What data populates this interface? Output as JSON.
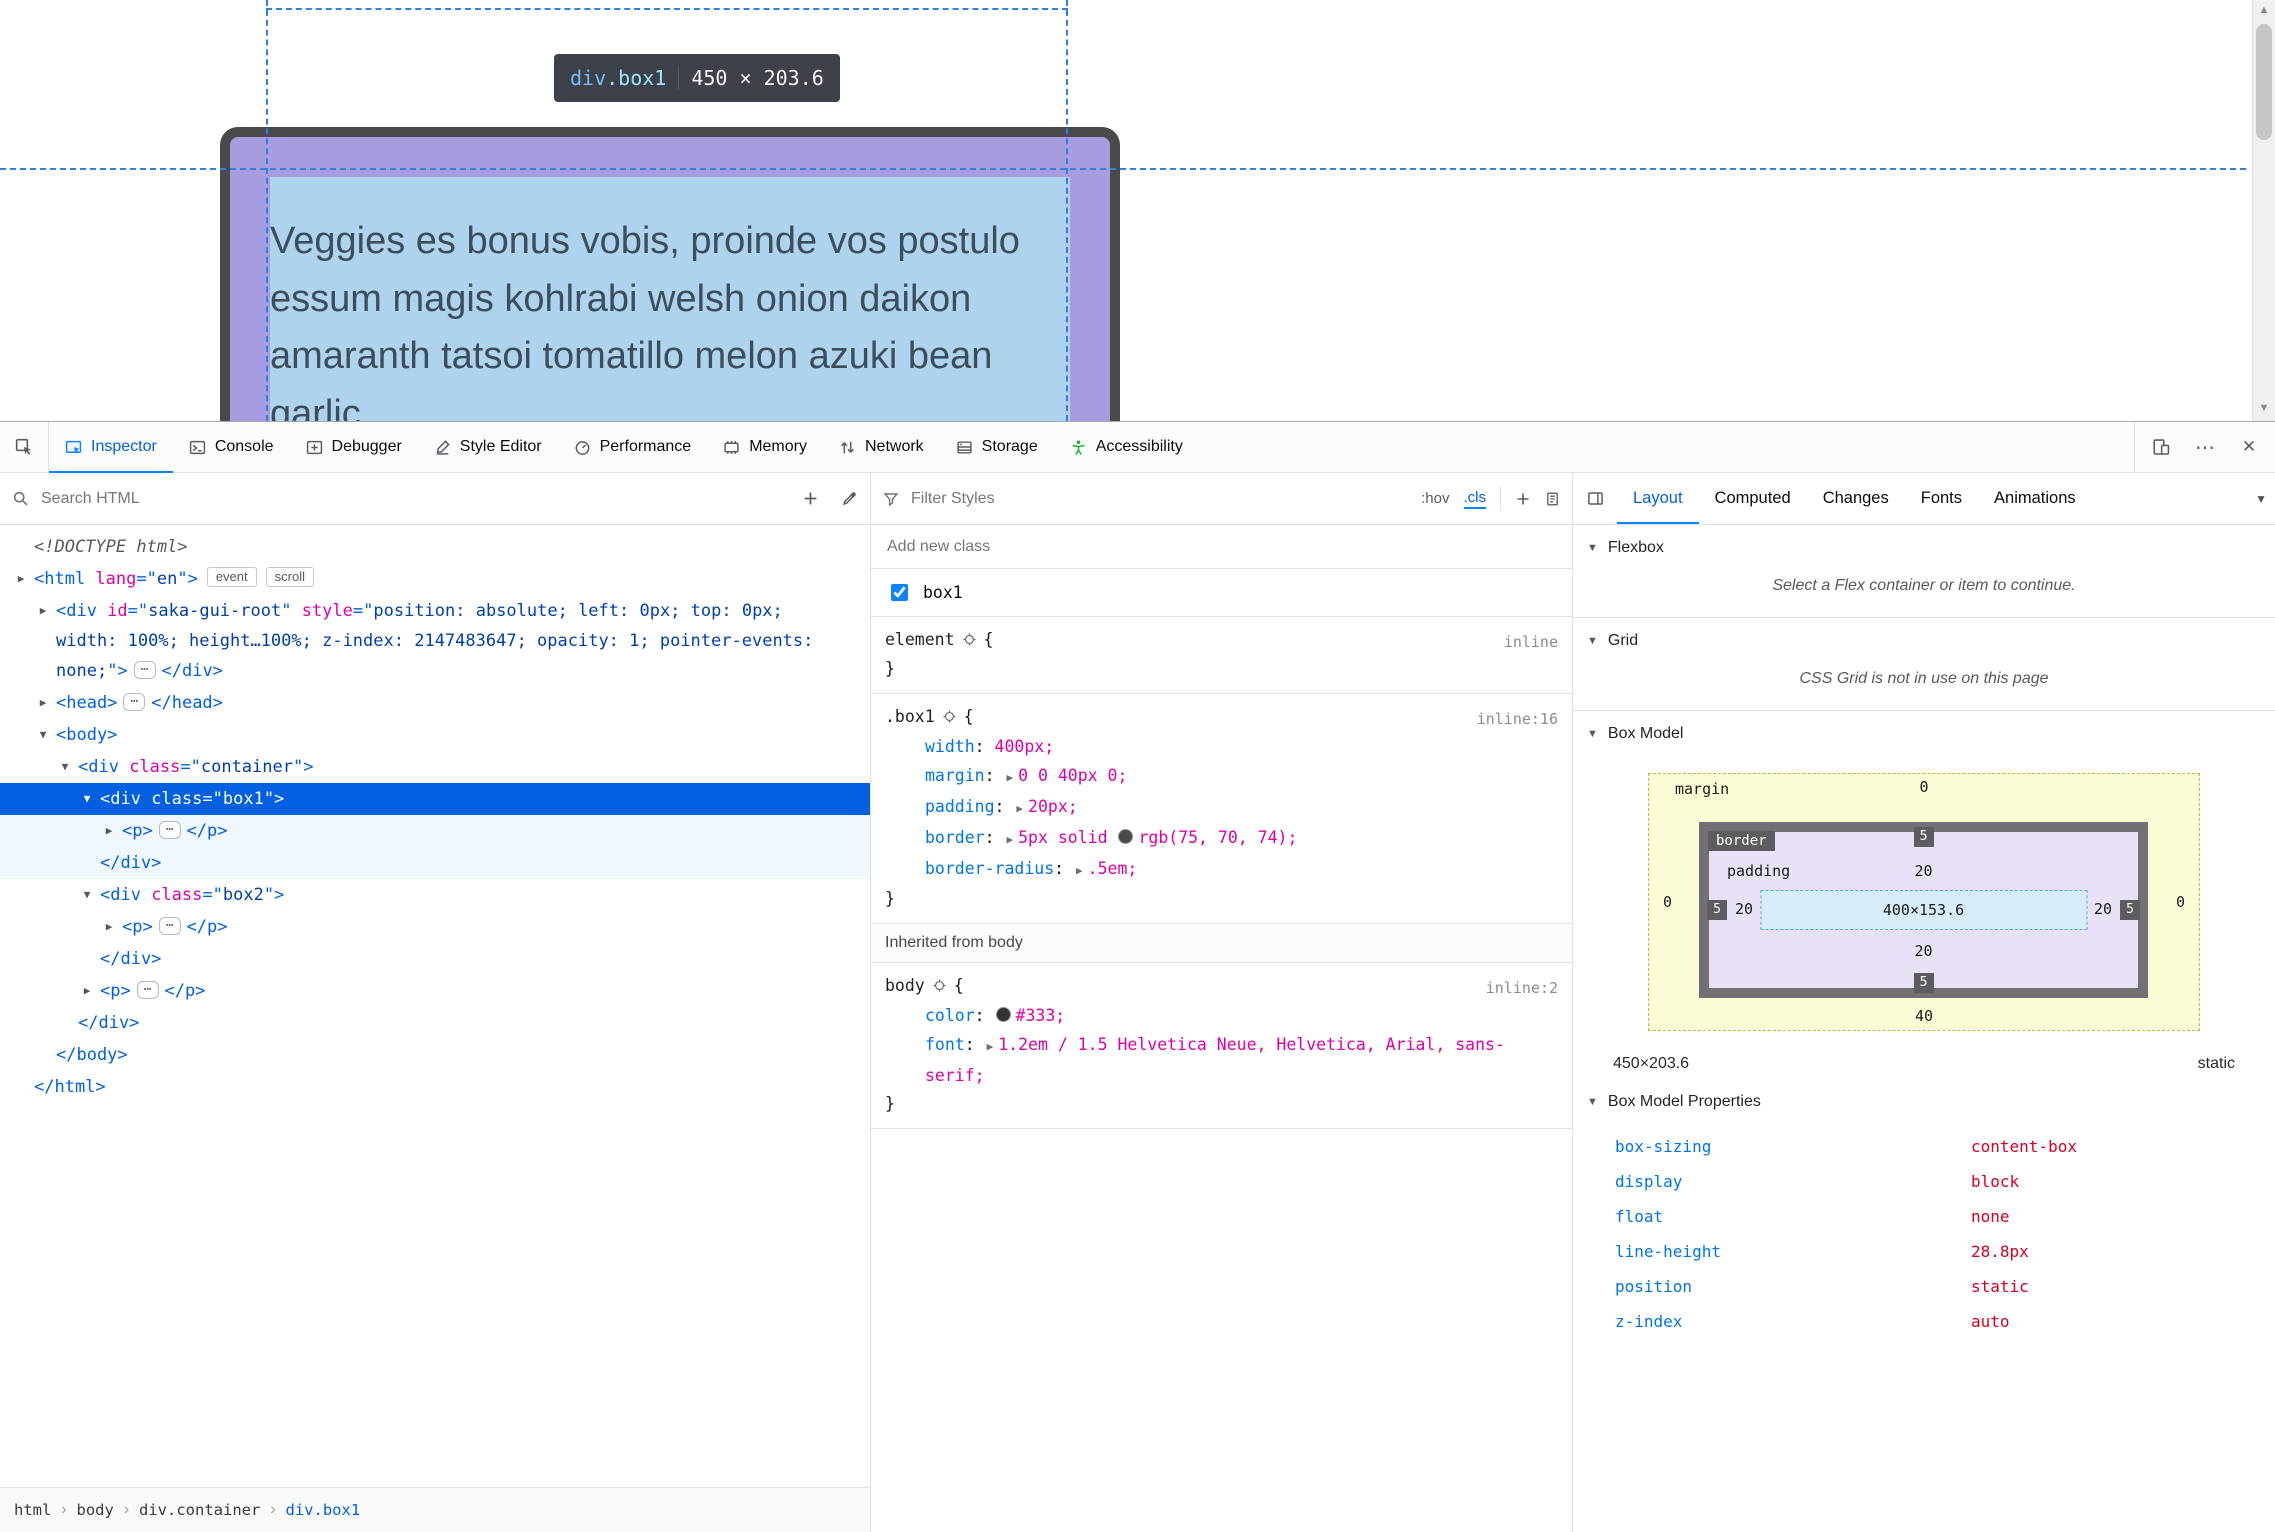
{
  "colors": {
    "accent": "#0060df",
    "selection_bg": "#0060df",
    "tag": "#0060df",
    "attr_name": "#dd00a9",
    "attr_value": "#003eaa",
    "property_name": "#0074e8",
    "property_value": "#dd00a9",
    "box_border_swatch": "#4b4a4a",
    "body_color_swatch": "#333333",
    "accessibility_icon": "#2bb236"
  },
  "page_view": {
    "tooltip": {
      "tag": "div",
      "cls": ".box1",
      "dims": "450 × 203.6"
    },
    "box_lines": [
      "Veggies es bonus vobis, proinde vos postulo",
      "essum magis kohlrabi welsh onion daikon",
      "amaranth tatsoi tomatillo melon azuki bean",
      "garlic"
    ]
  },
  "toolbar": {
    "tabs": [
      {
        "id": "inspector",
        "label": "Inspector",
        "icon": "inspector-icon",
        "active": true
      },
      {
        "id": "console",
        "label": "Console",
        "icon": "console-icon"
      },
      {
        "id": "debugger",
        "label": "Debugger",
        "icon": "debugger-icon"
      },
      {
        "id": "style-editor",
        "label": "Style Editor",
        "icon": "style-editor-icon"
      },
      {
        "id": "performance",
        "label": "Performance",
        "icon": "performance-icon"
      },
      {
        "id": "memory",
        "label": "Memory",
        "icon": "memory-icon"
      },
      {
        "id": "network",
        "label": "Network",
        "icon": "network-icon"
      },
      {
        "id": "storage",
        "label": "Storage",
        "icon": "storage-icon"
      },
      {
        "id": "accessibility",
        "label": "Accessibility",
        "icon": "accessibility-icon",
        "icon_color": "#2bb236"
      }
    ]
  },
  "markup": {
    "search_placeholder": "Search HTML",
    "rows": [
      {
        "name": "node-doctype",
        "indent": 0,
        "arrow": null,
        "parts": [
          {
            "c": "doc",
            "s": "<!DOCTYPE html>"
          }
        ]
      },
      {
        "name": "node-html",
        "indent": 0,
        "arrow": "c",
        "parts": [
          {
            "c": "tag",
            "s": "<html "
          },
          {
            "c": "an",
            "s": "lang"
          },
          {
            "c": "tag",
            "s": "=\""
          },
          {
            "c": "av",
            "s": "en"
          },
          {
            "c": "tag",
            "s": "\">"
          }
        ],
        "badges": [
          "event",
          "scroll"
        ]
      },
      {
        "name": "node-saka-gui-root",
        "indent": 1,
        "arrow": "c",
        "parts": [
          {
            "c": "tag",
            "s": "<div "
          },
          {
            "c": "an",
            "s": "id"
          },
          {
            "c": "tag",
            "s": "=\""
          },
          {
            "c": "av",
            "s": "saka-gui-root"
          },
          {
            "c": "tag",
            "s": "\" "
          },
          {
            "c": "an",
            "s": "style"
          },
          {
            "c": "tag",
            "s": "=\""
          },
          {
            "c": "av",
            "s": "position: absolute; left: 0px; top: 0px; width: 100%; height…100%; z-index: 2147483647; opacity: 1; pointer-events: none;"
          },
          {
            "c": "tag",
            "s": "\">"
          },
          {
            "c": "pill",
            "s": "⋯"
          },
          {
            "c": "tag",
            "s": "</div>"
          }
        ]
      },
      {
        "name": "node-head",
        "indent": 1,
        "arrow": "c",
        "parts": [
          {
            "c": "tag",
            "s": "<head>"
          },
          {
            "c": "pill",
            "s": "⋯"
          },
          {
            "c": "tag",
            "s": "</head>"
          }
        ]
      },
      {
        "name": "node-body",
        "indent": 1,
        "arrow": "o",
        "parts": [
          {
            "c": "tag",
            "s": "<body>"
          }
        ]
      },
      {
        "name": "node-div-container",
        "indent": 2,
        "arrow": "o",
        "parts": [
          {
            "c": "tag",
            "s": "<div "
          },
          {
            "c": "an",
            "s": "class"
          },
          {
            "c": "tag",
            "s": "=\""
          },
          {
            "c": "av",
            "s": "container"
          },
          {
            "c": "tag",
            "s": "\">"
          }
        ]
      },
      {
        "name": "node-div-box1",
        "indent": 3,
        "arrow": "o",
        "state": "selected",
        "parts": [
          {
            "c": "tag",
            "s": "<div "
          },
          {
            "c": "an",
            "s": "class"
          },
          {
            "c": "tag",
            "s": "=\""
          },
          {
            "c": "av",
            "s": "box1"
          },
          {
            "c": "tag",
            "s": "\">"
          }
        ]
      },
      {
        "name": "node-box1-p",
        "indent": 4,
        "arrow": "c",
        "state": "tint",
        "parts": [
          {
            "c": "tag",
            "s": "<p>"
          },
          {
            "c": "pill",
            "s": "⋯"
          },
          {
            "c": "tag",
            "s": "</p>"
          }
        ]
      },
      {
        "name": "node-box1-close",
        "indent": 3,
        "arrow": null,
        "state": "tint",
        "parts": [
          {
            "c": "tag",
            "s": "</div>"
          }
        ]
      },
      {
        "name": "node-div-box2",
        "indent": 3,
        "arrow": "o",
        "parts": [
          {
            "c": "tag",
            "s": "<div "
          },
          {
            "c": "an",
            "s": "class"
          },
          {
            "c": "tag",
            "s": "=\""
          },
          {
            "c": "av",
            "s": "box2"
          },
          {
            "c": "tag",
            "s": "\">"
          }
        ]
      },
      {
        "name": "node-box2-p",
        "indent": 4,
        "arrow": "c",
        "parts": [
          {
            "c": "tag",
            "s": "<p>"
          },
          {
            "c": "pill",
            "s": "⋯"
          },
          {
            "c": "tag",
            "s": "</p>"
          }
        ]
      },
      {
        "name": "node-box2-close",
        "indent": 3,
        "arrow": null,
        "parts": [
          {
            "c": "tag",
            "s": "</div>"
          }
        ]
      },
      {
        "name": "node-container-p",
        "indent": 3,
        "arrow": "c",
        "parts": [
          {
            "c": "tag",
            "s": "<p>"
          },
          {
            "c": "pill",
            "s": "⋯"
          },
          {
            "c": "tag",
            "s": "</p>"
          }
        ]
      },
      {
        "name": "node-container-close",
        "indent": 2,
        "arrow": null,
        "parts": [
          {
            "c": "tag",
            "s": "</div>"
          }
        ]
      },
      {
        "name": "node-body-close",
        "indent": 1,
        "arrow": null,
        "parts": [
          {
            "c": "tag",
            "s": "</body>"
          }
        ]
      },
      {
        "name": "node-html-close",
        "indent": 0,
        "arrow": null,
        "parts": [
          {
            "c": "tag",
            "s": "</html>"
          }
        ]
      }
    ],
    "breadcrumbs": [
      "html",
      "body",
      "div.container",
      "div.box1"
    ]
  },
  "rules": {
    "filter_placeholder": "Filter Styles",
    "pseudo_label": ":hov",
    "class_label": ".cls",
    "add_class_placeholder": "Add new class",
    "class_toggle": {
      "name": "box1",
      "checked": true
    },
    "sections": [
      {
        "type": "rule",
        "selector": "element",
        "link": "inline",
        "declarations": []
      },
      {
        "type": "rule",
        "selector": ".box1",
        "link": "inline:16",
        "declarations": [
          {
            "name": "width",
            "parts": [
              {
                "t": "t",
                "s": "400px"
              }
            ]
          },
          {
            "name": "margin",
            "expand": true,
            "parts": [
              {
                "t": "t",
                "s": "0 0 40px 0"
              }
            ]
          },
          {
            "name": "padding",
            "expand": true,
            "parts": [
              {
                "t": "t",
                "s": "20px"
              }
            ]
          },
          {
            "name": "border",
            "expand": true,
            "parts": [
              {
                "t": "t",
                "s": "5px solid "
              },
              {
                "t": "sw",
                "s": "#4b4a4a"
              },
              {
                "t": "t",
                "s": "rgb(75, 70, 74)"
              }
            ]
          },
          {
            "name": "border-radius",
            "expand": true,
            "parts": [
              {
                "t": "t",
                "s": ".5em"
              }
            ]
          }
        ]
      },
      {
        "type": "header",
        "label": "Inherited from body"
      },
      {
        "type": "rule",
        "selector": "body",
        "link": "inline:2",
        "declarations": [
          {
            "name": "color",
            "parts": [
              {
                "t": "sw",
                "s": "#333333"
              },
              {
                "t": "t",
                "s": "#333"
              }
            ]
          },
          {
            "name": "font",
            "expand": true,
            "parts": [
              {
                "t": "t",
                "s": "1.2em / 1.5 Helvetica Neue, Helvetica, Arial, sans-serif"
              }
            ]
          }
        ]
      }
    ]
  },
  "layout": {
    "tabs": [
      "Layout",
      "Computed",
      "Changes",
      "Fonts",
      "Animations"
    ],
    "flexbox": {
      "title": "Flexbox",
      "message": "Select a Flex container or item to continue."
    },
    "grid": {
      "title": "Grid",
      "message": "CSS Grid is not in use on this page"
    },
    "box_model": {
      "title": "Box Model",
      "labels": {
        "margin": "margin",
        "border": "border",
        "padding": "padding"
      },
      "margin": {
        "top": "0",
        "right": "0",
        "bottom": "40",
        "left": "0"
      },
      "border": {
        "top": "5",
        "right": "5",
        "bottom": "5",
        "left": "5"
      },
      "padding": {
        "top": "20",
        "right": "20",
        "bottom": "20",
        "left": "20"
      },
      "content": "400×153.6",
      "total": "450×203.6",
      "position": "static"
    },
    "properties_title": "Box Model Properties",
    "properties": [
      {
        "name": "box-sizing",
        "value": "content-box"
      },
      {
        "name": "display",
        "value": "block"
      },
      {
        "name": "float",
        "value": "none"
      },
      {
        "name": "line-height",
        "value": "28.8px"
      },
      {
        "name": "position",
        "value": "static"
      },
      {
        "name": "z-index",
        "value": "auto"
      }
    ]
  }
}
